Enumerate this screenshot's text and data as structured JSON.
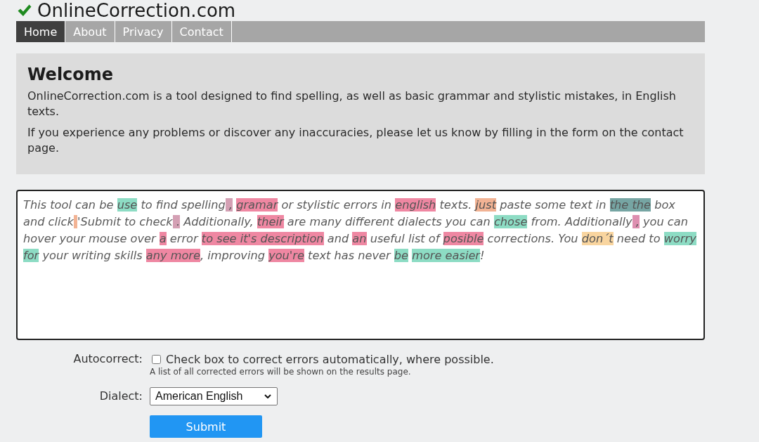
{
  "header": {
    "logo": "OnlineCorrection.com"
  },
  "nav": [
    {
      "label": "Home",
      "selected": true
    },
    {
      "label": "About",
      "selected": false
    },
    {
      "label": "Privacy",
      "selected": false
    },
    {
      "label": "Contact",
      "selected": false
    }
  ],
  "welcome": {
    "title": "Welcome",
    "paragraphs": [
      "OnlineCorrection.com is a tool designed to find spelling, as well as basic grammar and stylistic mistakes, in English texts.",
      "If you experience any problems or discover any inaccuracies, please let us know by filling in the form on the contact page."
    ]
  },
  "editor": {
    "segments": [
      {
        "kind": "plain",
        "text": "This tool can be "
      },
      {
        "kind": "highlight",
        "text": "use",
        "color": "#8ddcc4"
      },
      {
        "kind": "plain",
        "text": " to find spelling"
      },
      {
        "kind": "highlight",
        "text": " , ",
        "color": "#d4a0b4"
      },
      {
        "kind": "highlight",
        "text": "gramar",
        "color": "#ef87a2"
      },
      {
        "kind": "plain",
        "text": " or stylistic errors in "
      },
      {
        "kind": "highlight",
        "text": "english",
        "color": "#ef87a2"
      },
      {
        "kind": "plain",
        "text": " texts. "
      },
      {
        "kind": "highlight",
        "text": "just",
        "color": "#f2b394"
      },
      {
        "kind": "plain",
        "text": " paste some text in "
      },
      {
        "kind": "highlight",
        "text": "the the",
        "color": "#76a5a3"
      },
      {
        "kind": "plain",
        "text": " box and click"
      },
      {
        "kind": "blank",
        "color": "#f2b394"
      },
      {
        "kind": "plain",
        "text": "'Submit to check"
      },
      {
        "kind": "highlight",
        "text": " .",
        "color": "#d4a0b4"
      },
      {
        "kind": "plain",
        "text": " Additionally, "
      },
      {
        "kind": "highlight",
        "text": "their",
        "color": "#ef87a2"
      },
      {
        "kind": "plain",
        "text": " are many different dialects you can "
      },
      {
        "kind": "highlight",
        "text": "chose",
        "color": "#8ddcc4"
      },
      {
        "kind": "plain",
        "text": " from. Additionally"
      },
      {
        "kind": "highlight",
        "text": " ,",
        "color": "#de8fb0"
      },
      {
        "kind": "plain",
        "text": " you can hover your mouse over "
      },
      {
        "kind": "highlight",
        "text": "a",
        "color": "#ef87a2"
      },
      {
        "kind": "plain",
        "text": " error "
      },
      {
        "kind": "highlight",
        "text": "to see it's description",
        "color": "#ef87a2"
      },
      {
        "kind": "plain",
        "text": " and "
      },
      {
        "kind": "highlight",
        "text": "an",
        "color": "#ef87a2"
      },
      {
        "kind": "plain",
        "text": " useful list of "
      },
      {
        "kind": "highlight",
        "text": "posible",
        "color": "#ef87a2"
      },
      {
        "kind": "plain",
        "text": " corrections. You "
      },
      {
        "kind": "highlight",
        "text": "don´t",
        "color": "#f9d59f"
      },
      {
        "kind": "plain",
        "text": " need to "
      },
      {
        "kind": "highlight",
        "text": "worry ",
        "color": "#8ddcc4"
      },
      {
        "kind": "highlight",
        "text": "for",
        "color": "#8ddcc4"
      },
      {
        "kind": "plain",
        "text": " your writing skills "
      },
      {
        "kind": "highlight",
        "text": "any more",
        "color": "#ef87a2"
      },
      {
        "kind": "plain",
        "text": ", improving "
      },
      {
        "kind": "highlight",
        "text": "you're",
        "color": "#ef87a2"
      },
      {
        "kind": "plain",
        "text": " text has never "
      },
      {
        "kind": "highlight",
        "text": "be ",
        "color": "#8ddcc4"
      },
      {
        "kind": "highlight",
        "text": "more easier",
        "color": "#8ddcc4"
      },
      {
        "kind": "plain",
        "text": "!"
      }
    ]
  },
  "autocorrect": {
    "label": "Autocorrect:",
    "checked": false,
    "text": "Check box to correct errors automatically, where possible.",
    "hint": "A list of all corrected errors will be shown on the results page."
  },
  "dialect": {
    "label": "Dialect:",
    "value": "American English"
  },
  "submit": {
    "label": "Submit"
  }
}
